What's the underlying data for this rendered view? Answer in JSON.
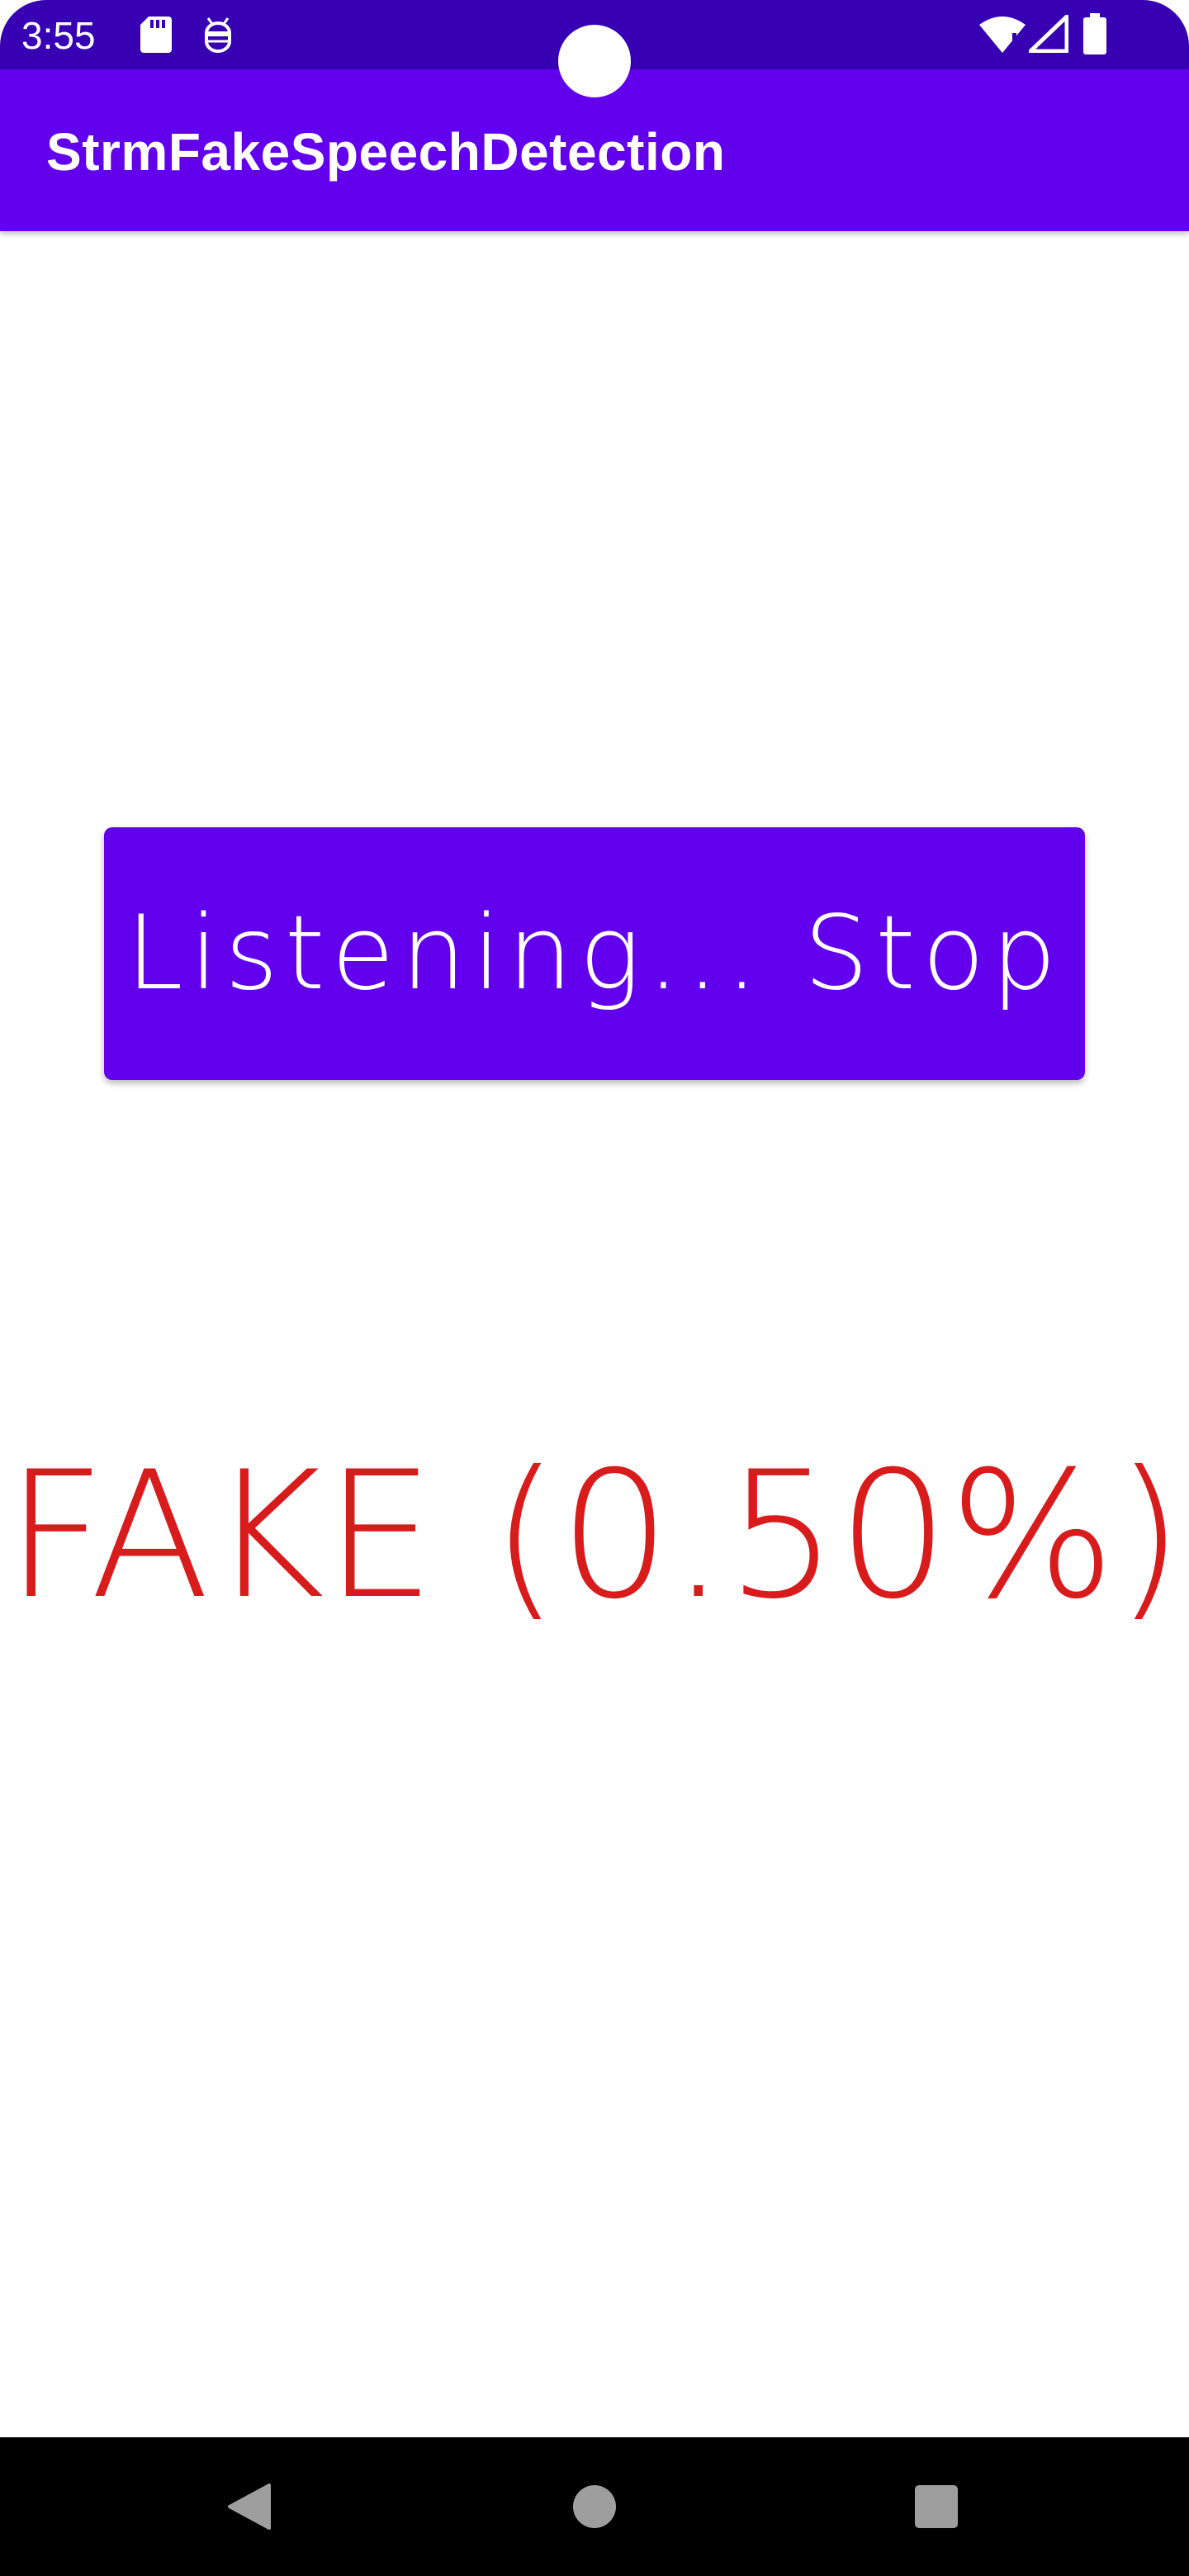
{
  "status_bar": {
    "time": "3:55",
    "icons": [
      "sd-card-icon",
      "android-debug-icon",
      "wifi-icon",
      "signal-icon",
      "battery-icon"
    ]
  },
  "app_bar": {
    "title": "StrmFakeSpeechDetection"
  },
  "main": {
    "listen_button_label": "Listening... Stop",
    "result_text": "FAKE (0.50%)"
  },
  "navigation": {
    "buttons": [
      "back-icon",
      "home-icon",
      "recents-icon"
    ]
  },
  "colors": {
    "status_bar": "#3700b3",
    "app_bar": "#6200ee",
    "button": "#6200ee",
    "result_text": "#d81b1b",
    "nav_bar": "#000000"
  }
}
